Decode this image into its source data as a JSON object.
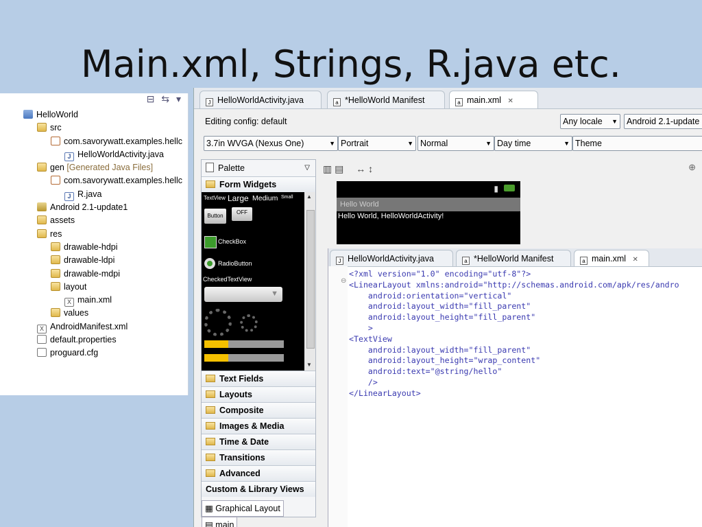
{
  "slide": {
    "title": "Main.xml, Strings, R.java etc."
  },
  "package_explorer": {
    "items": [
      {
        "label": "HelloWorld",
        "indent": 0,
        "icon": "project-icon"
      },
      {
        "label": "src",
        "indent": 1,
        "icon": "folder-icon"
      },
      {
        "label": "com.savorywatt.examples.hellc",
        "indent": 2,
        "icon": "package-icon"
      },
      {
        "label": "HelloWorldActivity.java",
        "indent": 3,
        "icon": "java-file-icon"
      },
      {
        "label": "gen",
        "suffix": "[Generated Java Files]",
        "indent": 1,
        "icon": "folder-icon"
      },
      {
        "label": "com.savorywatt.examples.hellc",
        "indent": 2,
        "icon": "package-icon"
      },
      {
        "label": "R.java",
        "indent": 3,
        "icon": "java-file-icon"
      },
      {
        "label": "Android 2.1-update1",
        "indent": 1,
        "icon": "library-icon"
      },
      {
        "label": "assets",
        "indent": 1,
        "icon": "folder-icon"
      },
      {
        "label": "res",
        "indent": 1,
        "icon": "folder-icon"
      },
      {
        "label": "drawable-hdpi",
        "indent": 2,
        "icon": "folder-icon"
      },
      {
        "label": "drawable-ldpi",
        "indent": 2,
        "icon": "folder-icon"
      },
      {
        "label": "drawable-mdpi",
        "indent": 2,
        "icon": "folder-icon"
      },
      {
        "label": "layout",
        "indent": 2,
        "icon": "folder-icon"
      },
      {
        "label": "main.xml",
        "indent": 3,
        "icon": "xml-file-icon"
      },
      {
        "label": "values",
        "indent": 2,
        "icon": "folder-icon"
      },
      {
        "label": "AndroidManifest.xml",
        "indent": 1,
        "icon": "xml-file-icon"
      },
      {
        "label": "default.properties",
        "indent": 1,
        "icon": "file-icon"
      },
      {
        "label": "proguard.cfg",
        "indent": 1,
        "icon": "file-icon"
      }
    ]
  },
  "editor": {
    "tabs": [
      {
        "label": "HelloWorldActivity.java",
        "icon": "J"
      },
      {
        "label": "*HelloWorld Manifest",
        "icon": "a"
      },
      {
        "label": "main.xml",
        "icon": "a",
        "close": "✕"
      }
    ],
    "editing_config": "Editing config:  default",
    "locale": "Any locale",
    "target": "Android 2.1-update",
    "device": "3.7in WVGA (Nexus One)",
    "orientation": "Portrait",
    "mode": "Normal",
    "time": "Day time",
    "theme": "Theme"
  },
  "palette": {
    "title": "Palette",
    "form_widgets": "Form Widgets",
    "widget_textview": "TextView",
    "widget_large": "Large",
    "widget_medium": "Medium",
    "widget_small": "Small",
    "widget_button": "Button",
    "widget_toggle": "OFF",
    "widget_checkbox": "CheckBox",
    "widget_radio": "RadioButton",
    "widget_checkedtext": "CheckedTextView",
    "seekbar1": 0.3,
    "seekbar2": 0.3,
    "sections": [
      "Text Fields",
      "Layouts",
      "Composite",
      "Images & Media",
      "Time & Date",
      "Transitions",
      "Advanced",
      "Custom & Library Views"
    ]
  },
  "bottom_tabs": {
    "graphical": "Graphical Layout",
    "source": "main"
  },
  "preview": {
    "app_title": "Hello World",
    "text": "Hello World, HelloWorldActivity!"
  },
  "source": {
    "tabs": [
      {
        "label": "HelloWorldActivity.java",
        "icon": "J"
      },
      {
        "label": "*HelloWorld Manifest",
        "icon": "a"
      },
      {
        "label": "main.xml",
        "icon": "a",
        "close": "✕"
      }
    ],
    "lines": [
      "<?xml version=\"1.0\" encoding=\"utf-8\"?>",
      "<LinearLayout xmlns:android=\"http://schemas.android.com/apk/res/andro",
      "    android:orientation=\"vertical\"",
      "    android:layout_width=\"fill_parent\"",
      "    android:layout_height=\"fill_parent\"",
      "    >",
      "<TextView",
      "    android:layout_width=\"fill_parent\"",
      "    android:layout_height=\"wrap_content\"",
      "    android:text=\"@string/hello\"",
      "    />",
      "</LinearLayout>"
    ]
  }
}
